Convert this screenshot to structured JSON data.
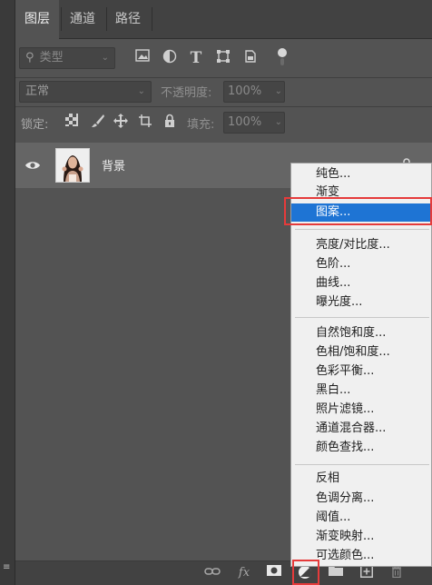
{
  "tabs": [
    {
      "label": "图层"
    },
    {
      "label": "通道"
    },
    {
      "label": "路径"
    }
  ],
  "filter": {
    "kind_placeholder": "类型"
  },
  "blend": {
    "mode": "正常",
    "opacity_label": "不透明度:",
    "opacity_value": "100%"
  },
  "lock": {
    "label": "锁定:",
    "fill_label": "填充:",
    "fill_value": "100%"
  },
  "layer": {
    "name": "背景"
  },
  "menu": {
    "group1": [
      "纯色...",
      "渐变",
      "图案..."
    ],
    "group2": [
      "亮度/对比度...",
      "色阶...",
      "曲线...",
      "曝光度..."
    ],
    "group3": [
      "自然饱和度...",
      "色相/饱和度...",
      "色彩平衡...",
      "黑白...",
      "照片滤镜...",
      "通道混合器...",
      "颜色查找..."
    ],
    "group4": [
      "反相",
      "色调分离...",
      "阈值...",
      "渐变映射...",
      "可选颜色..."
    ]
  },
  "bottom_icons": {
    "fx": "fx"
  },
  "colors": {
    "highlight": "#1e74d4",
    "annotation_red": "#e53b3b"
  }
}
